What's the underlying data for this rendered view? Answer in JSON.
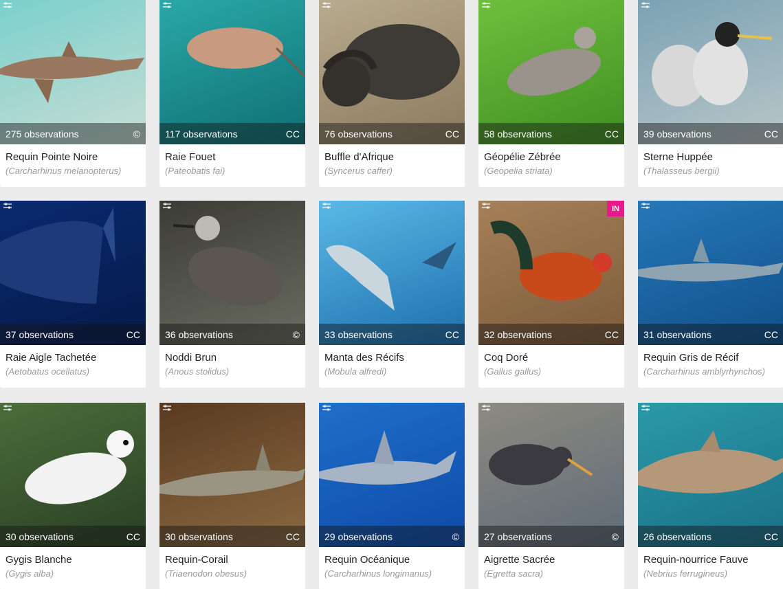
{
  "colors": {
    "page_bg": "#ececec",
    "card_bg": "#ffffff",
    "name_text": "#222222",
    "sci_text": "#9a9a9a",
    "badge_in": "#e8178a"
  },
  "icons": {
    "filter": "sliders-icon"
  },
  "cards": [
    {
      "count": "275 observations",
      "license": "©",
      "name": "Requin Pointe Noire",
      "sci": "(Carcharhinus melanopterus)",
      "scene": [
        "#7ad0cc",
        "#c8ddd4"
      ],
      "subject": "shark-sand"
    },
    {
      "count": "117 observations",
      "license": "CC",
      "name": "Raie Fouet",
      "sci": "(Pateobatis fai)",
      "scene": [
        "#2aa8a8",
        "#0e6f72"
      ],
      "subject": "stingray"
    },
    {
      "count": "76 observations",
      "license": "CC",
      "name": "Buffle d'Afrique",
      "sci": "(Syncerus caffer)",
      "scene": [
        "#b9ab8e",
        "#8a7a5e"
      ],
      "subject": "buffalo"
    },
    {
      "count": "58 observations",
      "license": "CC",
      "name": "Géopélie Zébrée",
      "sci": "(Geopelia striata)",
      "scene": [
        "#6fbf3d",
        "#3f8f22"
      ],
      "subject": "dove"
    },
    {
      "count": "39 observations",
      "license": "CC",
      "name": "Sterne Huppée",
      "sci": "(Thalasseus bergii)",
      "scene": [
        "#7aa2b4",
        "#b9c6c8"
      ],
      "subject": "terns"
    },
    {
      "count": "37 observations",
      "license": "CC",
      "name": "Raie Aigle Tachetée",
      "sci": "(Aetobatus ocellatus)",
      "scene": [
        "#0a2a6e",
        "#041a4a"
      ],
      "subject": "eagle-ray"
    },
    {
      "count": "36 observations",
      "license": "©",
      "name": "Noddi Brun",
      "sci": "(Anous stolidus)",
      "scene": [
        "#3c3c36",
        "#6a6c60"
      ],
      "subject": "noddy"
    },
    {
      "count": "33 observations",
      "license": "CC",
      "name": "Manta des Récifs",
      "sci": "(Mobula alfredi)",
      "scene": [
        "#5bb9e6",
        "#1c6fae"
      ],
      "subject": "manta"
    },
    {
      "count": "32 observations",
      "license": "CC",
      "name": "Coq Doré",
      "sci": "(Gallus gallus)",
      "scene": [
        "#a58058",
        "#7d5b3a"
      ],
      "subject": "rooster",
      "badge": "IN"
    },
    {
      "count": "31 observations",
      "license": "CC",
      "name": "Requin Gris de Récif",
      "sci": "(Carcharhinus amblyrhynchos)",
      "scene": [
        "#2778b8",
        "#0f4f8a"
      ],
      "subject": "grey-shark"
    },
    {
      "count": "30 observations",
      "license": "CC",
      "name": "Gygis Blanche",
      "sci": "(Gygis alba)",
      "scene": [
        "#4a6e3a",
        "#2a3e24"
      ],
      "subject": "white-tern"
    },
    {
      "count": "30 observations",
      "license": "CC",
      "name": "Requin-Corail",
      "sci": "(Triaenodon obesus)",
      "scene": [
        "#5a3a20",
        "#8a6a42"
      ],
      "subject": "reef-shark"
    },
    {
      "count": "29 observations",
      "license": "©",
      "name": "Requin Océanique",
      "sci": "(Carcharhinus longimanus)",
      "scene": [
        "#1f6fc8",
        "#0d4aa8"
      ],
      "subject": "oceanic-shark"
    },
    {
      "count": "27 observations",
      "license": "©",
      "name": "Aigrette Sacrée",
      "sci": "(Egretta sacra)",
      "scene": [
        "#8d8a80",
        "#5f6b78"
      ],
      "subject": "egret"
    },
    {
      "count": "26 observations",
      "license": "CC",
      "name": "Requin-nourrice Fauve",
      "sci": "(Nebrius ferrugineus)",
      "scene": [
        "#2a9aa8",
        "#1a6f88"
      ],
      "subject": "nurse-shark"
    }
  ]
}
